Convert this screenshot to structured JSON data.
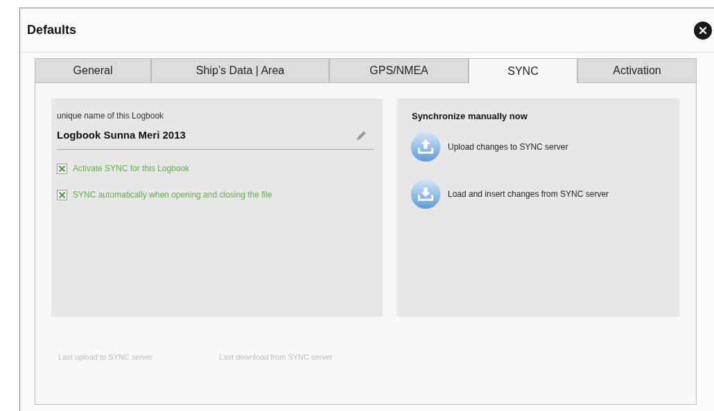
{
  "window": {
    "title": "Defaults"
  },
  "tabs": [
    {
      "label": "General",
      "selected": false
    },
    {
      "label": "Ship’s Data  | Area",
      "selected": false
    },
    {
      "label": "GPS/NMEA",
      "selected": false
    },
    {
      "label": "SYNC",
      "selected": true
    },
    {
      "label": "Activation",
      "selected": false
    }
  ],
  "logbook": {
    "label": "unique name of this Logbook",
    "value": "Logbook Sunna Meri 2013"
  },
  "options": [
    {
      "label": "Activate SYNC for this Logbook",
      "checked": true
    },
    {
      "label": "SYNC automatically when opening and closing the file",
      "checked": true
    }
  ],
  "sync": {
    "title": "Synchronize manually now",
    "actions": [
      {
        "kind": "upload",
        "label": "Upload changes to SYNC server"
      },
      {
        "kind": "download",
        "label": "Load and insert changes from SYNC server"
      }
    ]
  },
  "footer": [
    "Last upload to SYNC server",
    "Last download from SYNC server"
  ]
}
